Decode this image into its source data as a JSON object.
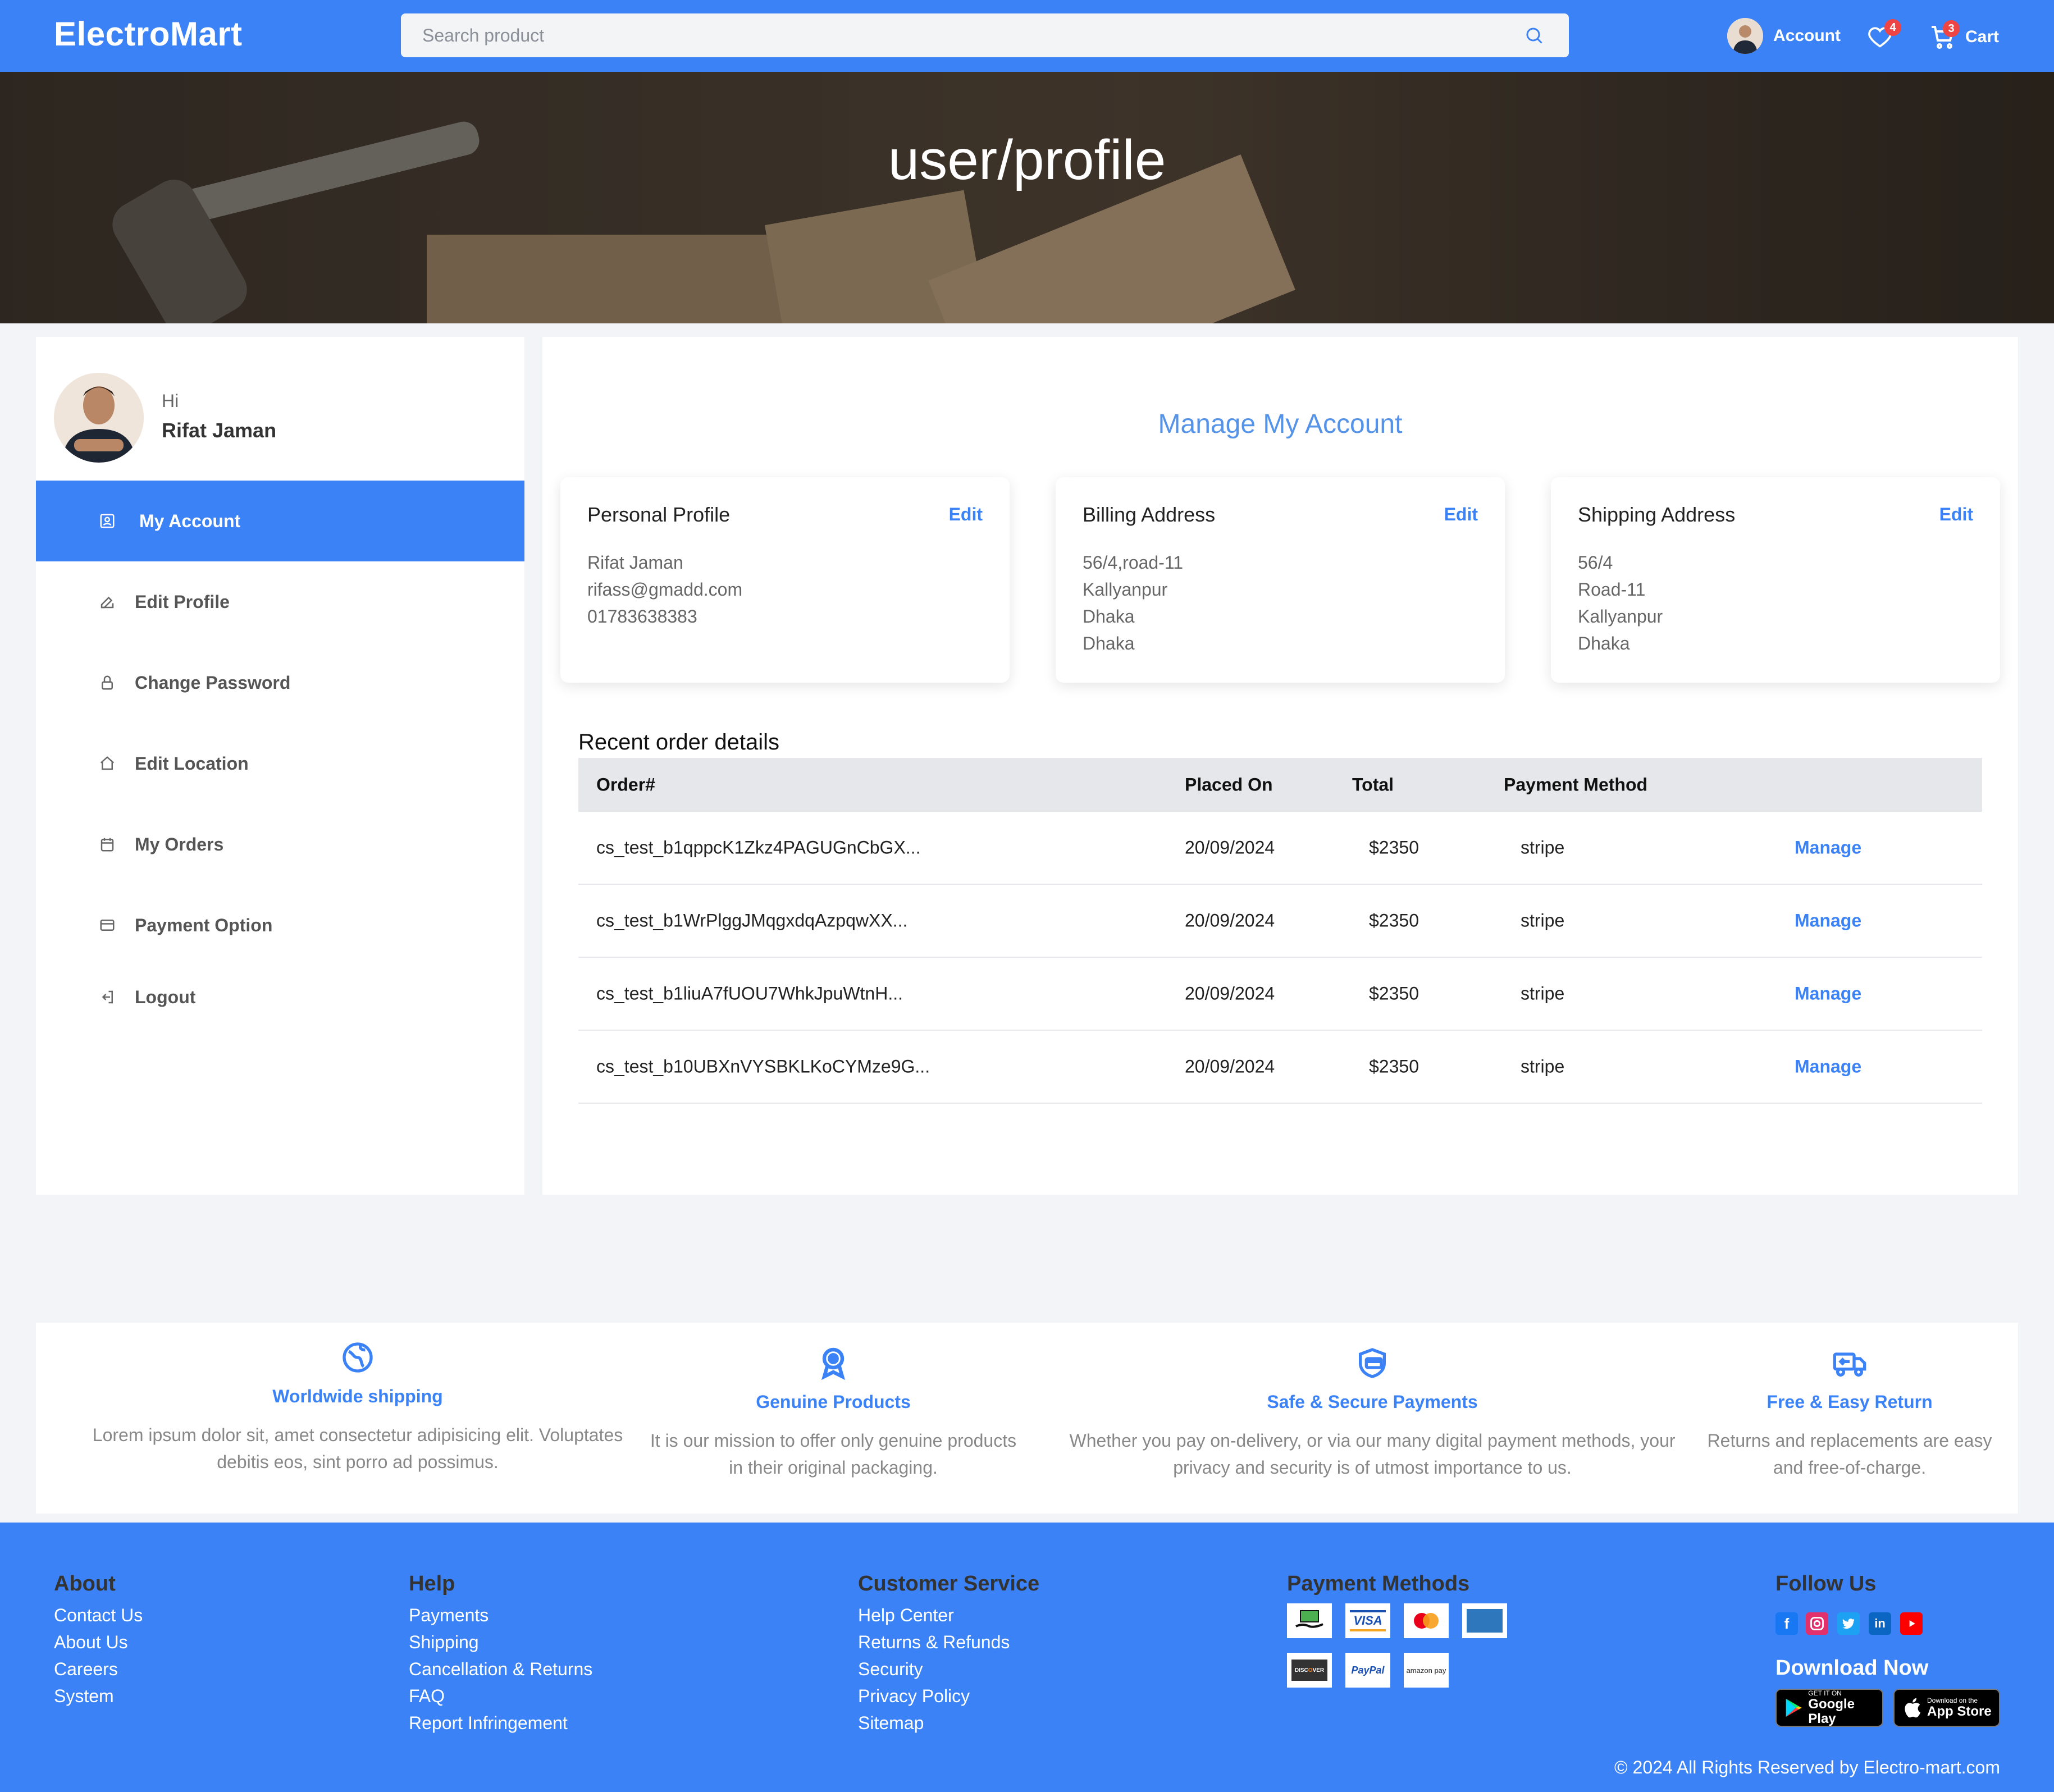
{
  "header": {
    "logo": "ElectroMart",
    "search_placeholder": "Search product",
    "account_label": "Account",
    "wishlist_count": "4",
    "cart_count": "3",
    "cart_label": "Cart"
  },
  "hero": {
    "title": "user/profile"
  },
  "sidebar": {
    "greeting": "Hi",
    "user_name": "Rifat Jaman",
    "items": [
      {
        "label": "My Account",
        "icon": "user-square-icon",
        "active": true
      },
      {
        "label": "Edit Profile",
        "icon": "edit-icon"
      },
      {
        "label": "Change Password",
        "icon": "lock-icon"
      },
      {
        "label": "Edit Location",
        "icon": "home-icon"
      },
      {
        "label": "My Orders",
        "icon": "calendar-icon"
      },
      {
        "label": "Payment Option",
        "icon": "credit-card-icon"
      },
      {
        "label": "Logout",
        "icon": "logout-icon"
      }
    ]
  },
  "main": {
    "title": "Manage My Account",
    "cards": [
      {
        "title": "Personal Profile",
        "edit": "Edit",
        "lines": [
          "Rifat Jaman",
          "rifass@gmadd.com",
          "01783638383"
        ]
      },
      {
        "title": "Billing Address",
        "edit": "Edit",
        "lines": [
          "56/4,road-11",
          "Kallyanpur",
          "Dhaka",
          "Dhaka"
        ]
      },
      {
        "title": "Shipping Address",
        "edit": "Edit",
        "lines": [
          "56/4",
          "Road-11",
          "Kallyanpur",
          "Dhaka"
        ]
      }
    ],
    "orders_title": "Recent order details",
    "columns": [
      "Order#",
      "Placed On",
      "Total",
      "Payment Method"
    ],
    "orders": [
      {
        "id": "cs_test_b1qppcK1Zkz4PAGUGnCbGX...",
        "date": "20/09/2024",
        "total": "$2350",
        "method": "stripe",
        "action": "Manage"
      },
      {
        "id": "cs_test_b1WrPlggJMqgxdqAzpqwXX...",
        "date": "20/09/2024",
        "total": "$2350",
        "method": "stripe",
        "action": "Manage"
      },
      {
        "id": "cs_test_b1liuA7fUOU7WhkJpuWtnH...",
        "date": "20/09/2024",
        "total": "$2350",
        "method": "stripe",
        "action": "Manage"
      },
      {
        "id": "cs_test_b10UBXnVYSBKLKoCYMze9G...",
        "date": "20/09/2024",
        "total": "$2350",
        "method": "stripe",
        "action": "Manage"
      }
    ]
  },
  "features": [
    {
      "title": "Worldwide shipping",
      "desc1": "Lorem ipsum dolor sit, amet consectetur adipisicing elit. Voluptates",
      "desc2": "debitis eos, sint porro ad possimus.",
      "icon": "globe-icon"
    },
    {
      "title": "Genuine Products",
      "desc1": "It is our mission to offer only genuine products",
      "desc2": "in their original packaging.",
      "icon": "award-icon"
    },
    {
      "title": "Safe & Secure Payments",
      "desc1": "Whether you pay on-delivery, or via our many digital payment methods, your",
      "desc2": "privacy and security is of utmost importance to us.",
      "icon": "shield-card-icon"
    },
    {
      "title": "Free & Easy Return",
      "desc1": "Returns and replacements are easy",
      "desc2": "and free-of-charge.",
      "icon": "return-truck-icon"
    }
  ],
  "footer": {
    "about": {
      "title": "About",
      "links": [
        "Contact Us",
        "About Us",
        "Careers",
        "System"
      ]
    },
    "help": {
      "title": "Help",
      "links": [
        "Payments",
        "Shipping",
        "Cancellation & Returns",
        "FAQ",
        "Report Infringement"
      ]
    },
    "customer_service": {
      "title": "Customer Service",
      "links": [
        "Help Center",
        "Returns & Refunds",
        "Security",
        "Privacy Policy",
        "Sitemap"
      ]
    },
    "payment_methods": {
      "title": "Payment Methods",
      "logos": [
        "cash-on-delivery",
        "VISA",
        "MasterCard",
        "AMEX",
        "DISCOVER",
        "PayPal",
        "amazon pay"
      ]
    },
    "follow_us": {
      "title": "Follow Us",
      "networks": [
        "facebook",
        "instagram",
        "twitter",
        "linkedin",
        "youtube"
      ]
    },
    "download": {
      "title": "Download Now",
      "google_small": "GET IT ON",
      "google_big": "Google Play",
      "apple_small": "Download on the",
      "apple_big": "App Store"
    },
    "copyright": "© 2024 All Rights Reserved by Electro-mart.com"
  },
  "colors": {
    "primary": "#3b82f6",
    "title_blue": "#5593e8",
    "badge": "#ef4444"
  }
}
